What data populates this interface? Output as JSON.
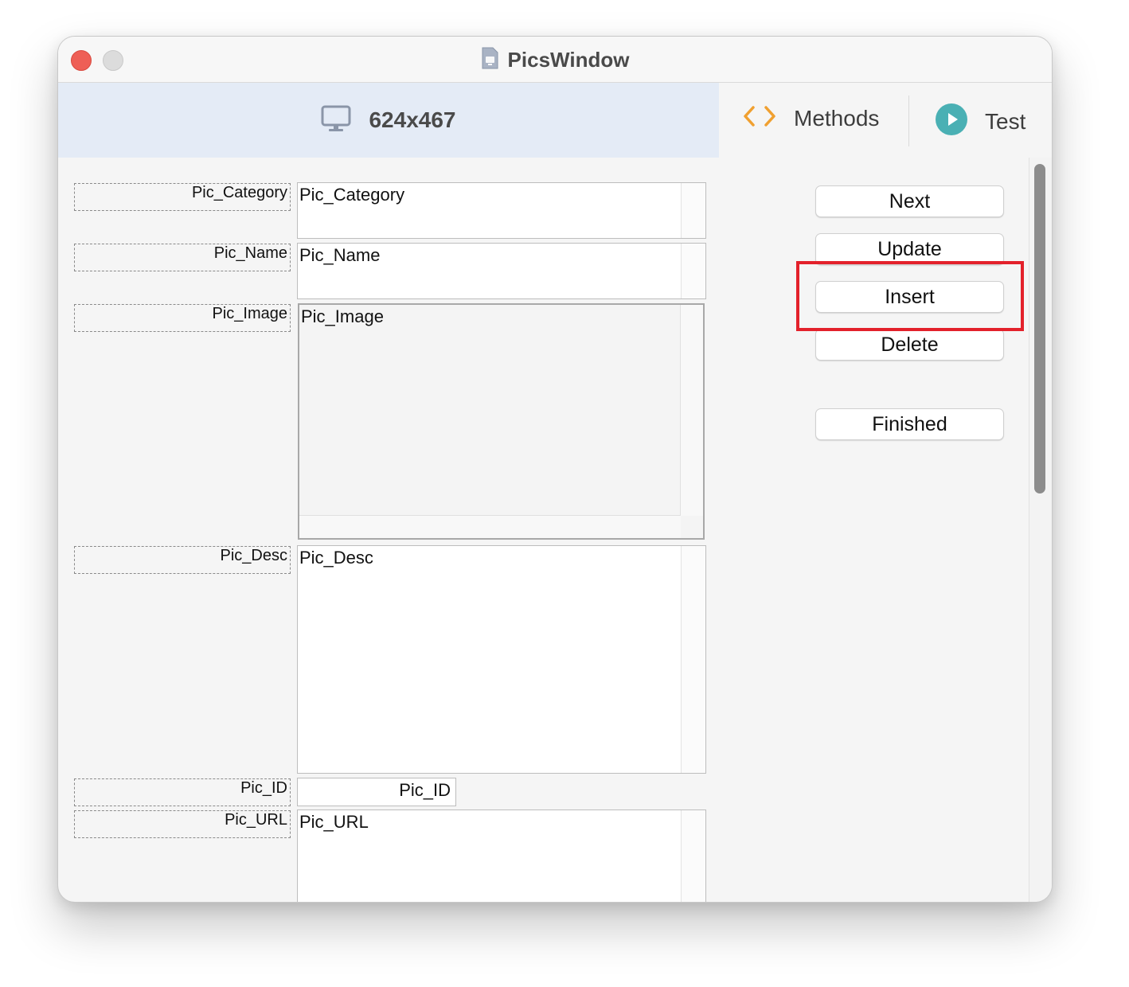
{
  "window": {
    "title": "PicsWindow"
  },
  "toolbar": {
    "size_label": "624x467",
    "methods_label": "Methods",
    "test_label": "Test"
  },
  "form": {
    "fields": {
      "category": {
        "label": "Pic_Category",
        "value": "Pic_Category"
      },
      "name": {
        "label": "Pic_Name",
        "value": "Pic_Name"
      },
      "image": {
        "label": "Pic_Image",
        "value": "Pic_Image"
      },
      "desc": {
        "label": "Pic_Desc",
        "value": "Pic_Desc"
      },
      "id": {
        "label": "Pic_ID",
        "value": "Pic_ID"
      },
      "url": {
        "label": "Pic_URL",
        "value": "Pic_URL"
      }
    }
  },
  "buttons": {
    "next": "Next",
    "update": "Update",
    "insert": "Insert",
    "delete": "Delete",
    "finished": "Finished"
  },
  "colors": {
    "highlight": "#e3212b",
    "methods_icon": "#f0a030",
    "test_icon": "#4ab0b4",
    "size_tab_bg": "#e4ebf6"
  },
  "icons": {
    "document": "document-icon",
    "monitor": "monitor-icon",
    "methods": "code-brackets-icon",
    "test": "play-circle-icon"
  }
}
